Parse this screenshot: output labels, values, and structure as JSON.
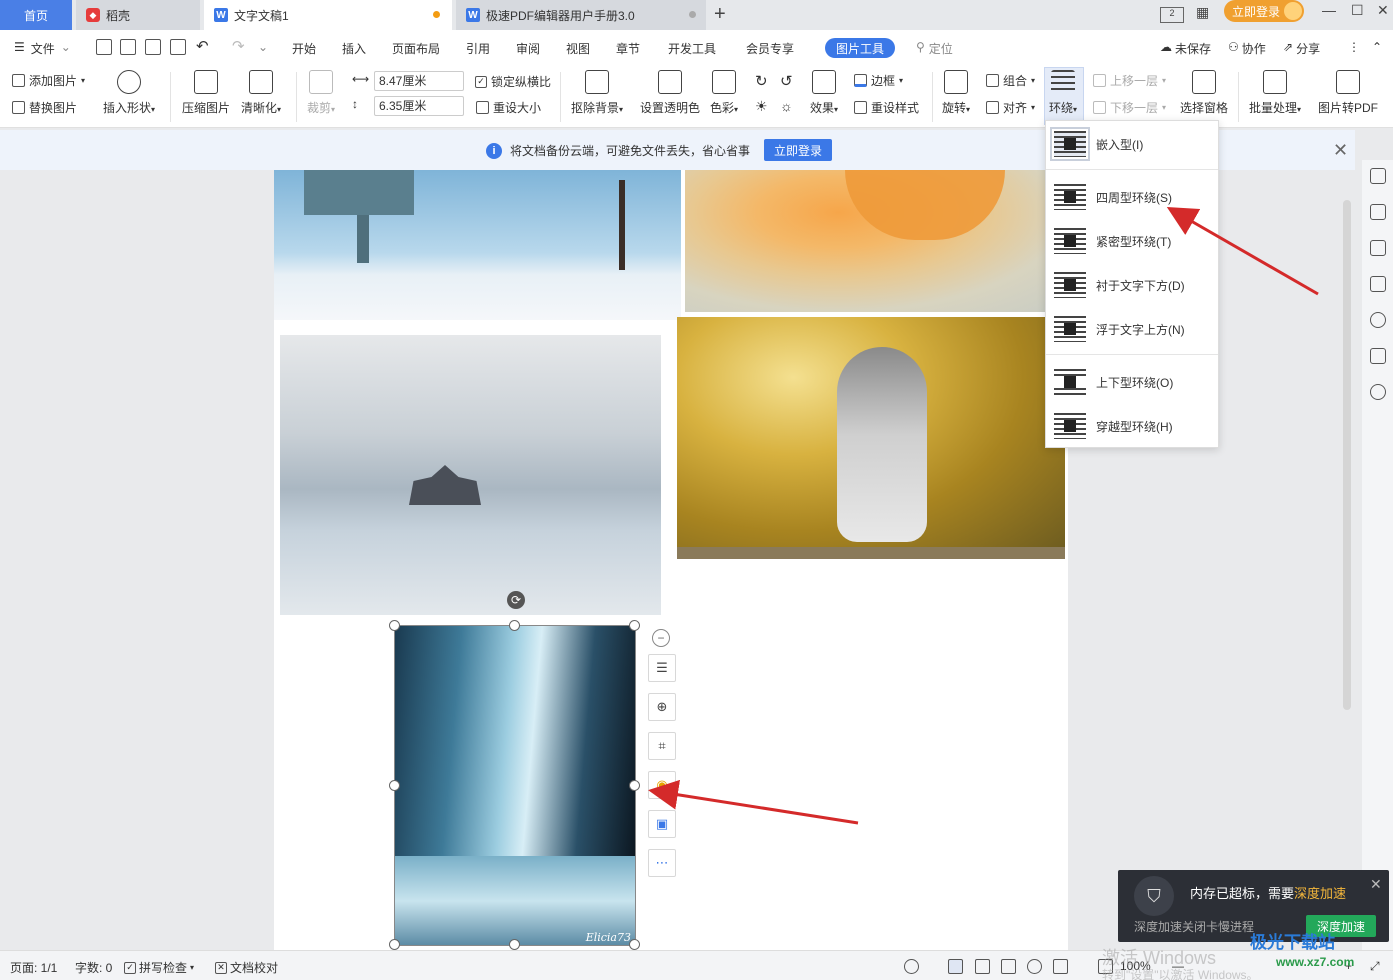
{
  "tabs": {
    "home": "首页",
    "daoke": "稻壳",
    "doc1": "文字文稿1",
    "pdf_manual": "极速PDF编辑器用户手册3.0",
    "new_tab": "+"
  },
  "titlebar": {
    "login_button": "立即登录"
  },
  "menubar": {
    "file": "文件",
    "items": [
      "开始",
      "插入",
      "页面布局",
      "引用",
      "审阅",
      "视图",
      "章节",
      "开发工具",
      "会员专享"
    ],
    "active_tab": "图片工具",
    "locate": "定位",
    "unsaved": "未保存",
    "collab": "协作",
    "share": "分享"
  },
  "ribbon": {
    "add_picture": "添加图片",
    "replace_picture": "替换图片",
    "insert_shape": "插入形状",
    "compress": "压缩图片",
    "sharpen": "清晰化",
    "crop": "裁剪",
    "width_value": "8.47厘米",
    "height_value": "6.35厘米",
    "lock_ratio": "锁定纵横比",
    "reset_size": "重设大小",
    "remove_bg": "抠除背景",
    "set_transparent": "设置透明色",
    "color": "色彩",
    "effects": "效果",
    "border": "边框",
    "reset_style": "重设样式",
    "rotate": "旋转",
    "group": "组合",
    "align": "对齐",
    "wrap": "环绕",
    "bring_forward": "上移一层",
    "send_backward": "下移一层",
    "selection_pane": "选择窗格",
    "batch": "批量处理",
    "to_pdf": "图片转PDF"
  },
  "notice": {
    "text": "将文档备份云端，可避免文件丢失，省心省事",
    "button": "立即登录"
  },
  "wrap_menu": {
    "items": [
      {
        "label": "嵌入型(I)",
        "icon": "inline-wrap-icon"
      },
      {
        "label": "四周型环绕(S)",
        "icon": "square-wrap-icon"
      },
      {
        "label": "紧密型环绕(T)",
        "icon": "tight-wrap-icon"
      },
      {
        "label": "衬于文字下方(D)",
        "icon": "behind-text-icon"
      },
      {
        "label": "浮于文字上方(N)",
        "icon": "in-front-text-icon"
      },
      {
        "label": "上下型环绕(O)",
        "icon": "top-bottom-wrap-icon"
      },
      {
        "label": "穿越型环绕(H)",
        "icon": "through-wrap-icon"
      }
    ]
  },
  "document": {
    "waterfall_signature": "Elicia73"
  },
  "statusbar": {
    "page": "页面: 1/1",
    "words": "字数: 0",
    "spellcheck": "拼写检查",
    "proofread": "文档校对",
    "zoom": "100%"
  },
  "toast": {
    "message_prefix": "内存已超标，需要",
    "message_highlight": "深度加速",
    "sub": "深度加速关闭卡慢进程",
    "button": "深度加速"
  },
  "watermarks": {
    "activate_line1": "激活 Windows",
    "activate_line2": "转到\"设置\"以激活 Windows。",
    "site_logo": "极光下载站",
    "site_url": "www.xz7.com"
  },
  "colors": {
    "accent": "#3b78e7",
    "home_tab": "#4a7fe6",
    "login_orange": "#f0a030",
    "annotation_arrow": "#d42a2a",
    "toast_button": "#23a85a"
  }
}
